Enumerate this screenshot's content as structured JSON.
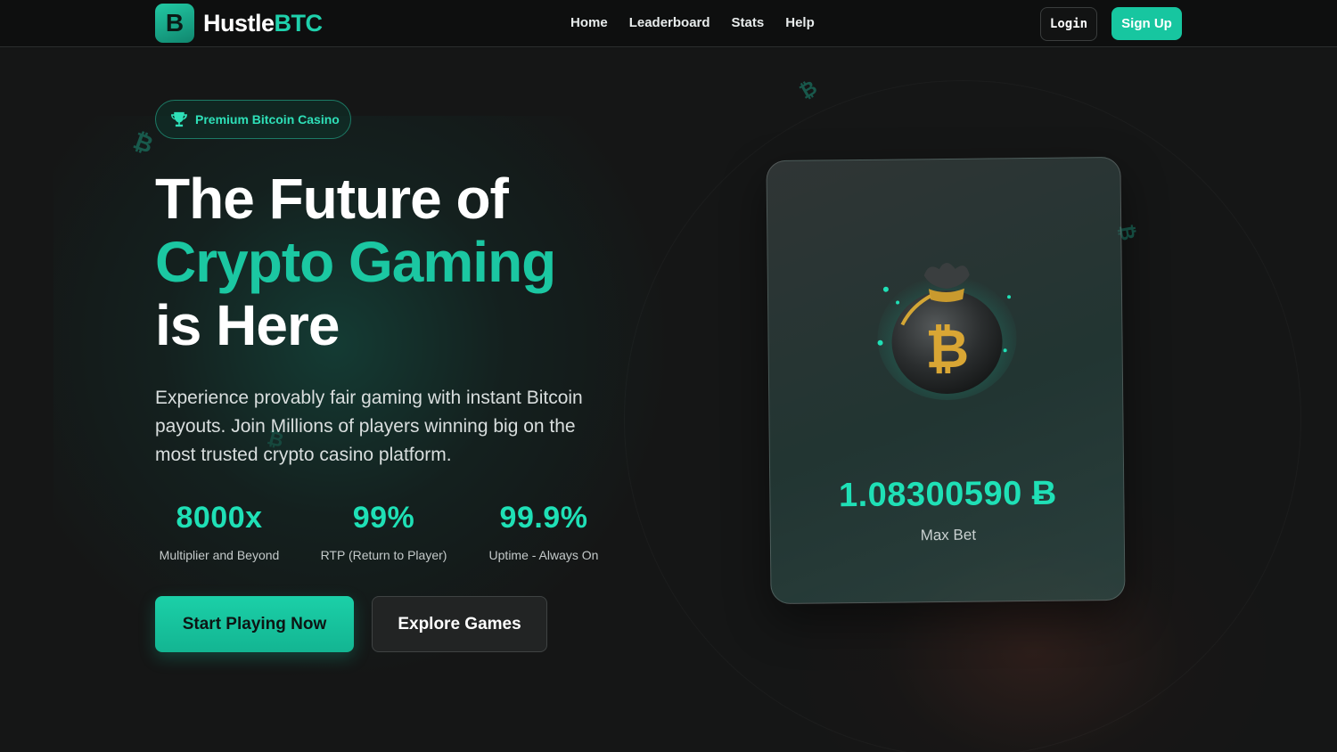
{
  "nav": {
    "logo_letter": "B",
    "logo_text_main": "Hustle",
    "logo_text_accent": "BTC",
    "links": [
      "Home",
      "Leaderboard",
      "Stats",
      "Help"
    ],
    "login_label": "Login",
    "signup_label": "Sign Up"
  },
  "hero": {
    "badge": "Premium Bitcoin Casino",
    "headline_line1": "The Future of",
    "headline_line2": "Crypto Gaming",
    "headline_line3": "is Here",
    "description": "Experience provably fair gaming with instant Bitcoin payouts. Join Millions of players winning big on the most trusted crypto casino platform.",
    "stats": [
      {
        "value": "8000x",
        "label": "Multiplier and Beyond"
      },
      {
        "value": "99%",
        "label": "RTP (Return to Player)"
      },
      {
        "value": "99.9%",
        "label": "Uptime - Always On"
      }
    ],
    "primary_cta": "Start Playing Now",
    "secondary_cta": "Explore Games"
  },
  "card": {
    "amount": "1.08300590 Ƀ",
    "label": "Max Bet"
  },
  "colors": {
    "accent": "#1bc7a2",
    "background": "#151616",
    "nav_background": "#0e0f0f"
  },
  "icons": [
    "trophy-icon",
    "bitcoin-bag-icon",
    "bitcoin-coin-icon"
  ]
}
